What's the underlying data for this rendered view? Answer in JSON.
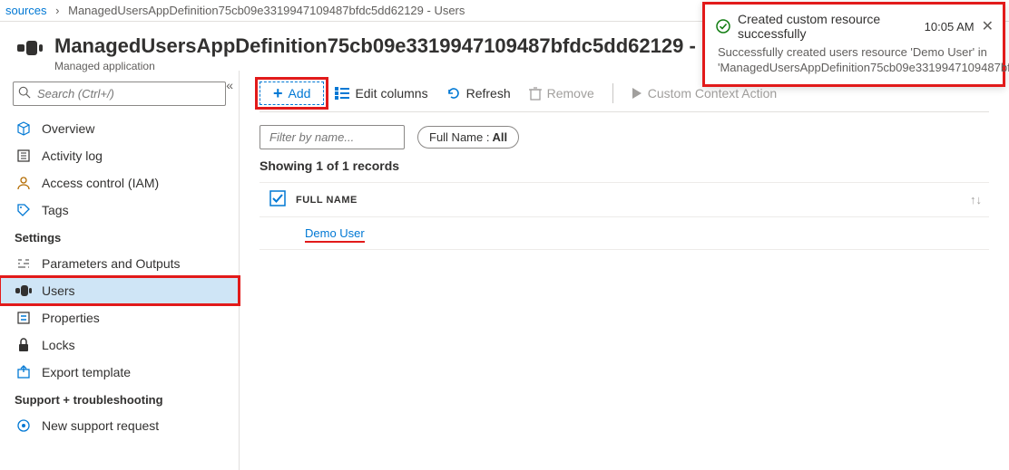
{
  "breadcrumb": {
    "parent": "sources",
    "current": "ManagedUsersAppDefinition75cb09e3319947109487bfdc5dd62129 - Users"
  },
  "header": {
    "title": "ManagedUsersAppDefinition75cb09e3319947109487bfdc5dd62129 - Users",
    "subtitle": "Managed application"
  },
  "sidebar": {
    "search_placeholder": "Search (Ctrl+/)",
    "items": [
      {
        "icon": "overview",
        "label": "Overview"
      },
      {
        "icon": "activity",
        "label": "Activity log"
      },
      {
        "icon": "access",
        "label": "Access control (IAM)"
      },
      {
        "icon": "tags",
        "label": "Tags"
      }
    ],
    "section_settings": "Settings",
    "settings_items": [
      {
        "icon": "params",
        "label": "Parameters and Outputs"
      },
      {
        "icon": "users",
        "label": "Users",
        "active": true
      },
      {
        "icon": "properties",
        "label": "Properties"
      },
      {
        "icon": "locks",
        "label": "Locks"
      },
      {
        "icon": "export",
        "label": "Export template"
      }
    ],
    "section_support": "Support + troubleshooting",
    "support_items": [
      {
        "icon": "support",
        "label": "New support request"
      }
    ]
  },
  "toolbar": {
    "add": "Add",
    "edit_columns": "Edit columns",
    "refresh": "Refresh",
    "remove": "Remove",
    "custom": "Custom Context Action"
  },
  "filters": {
    "name_placeholder": "Filter by name...",
    "full_name_label": "Full Name :",
    "full_name_value": "All"
  },
  "listing": {
    "showing": "Showing 1 of 1 records",
    "col_full_name": "FULL NAME",
    "rows": [
      {
        "full_name": "Demo User"
      }
    ]
  },
  "toast": {
    "title": "Created custom resource successfully",
    "time": "10:05 AM",
    "body": "Successfully created users resource 'Demo User' in 'ManagedUsersAppDefinition75cb09e3319947109487bf..."
  }
}
